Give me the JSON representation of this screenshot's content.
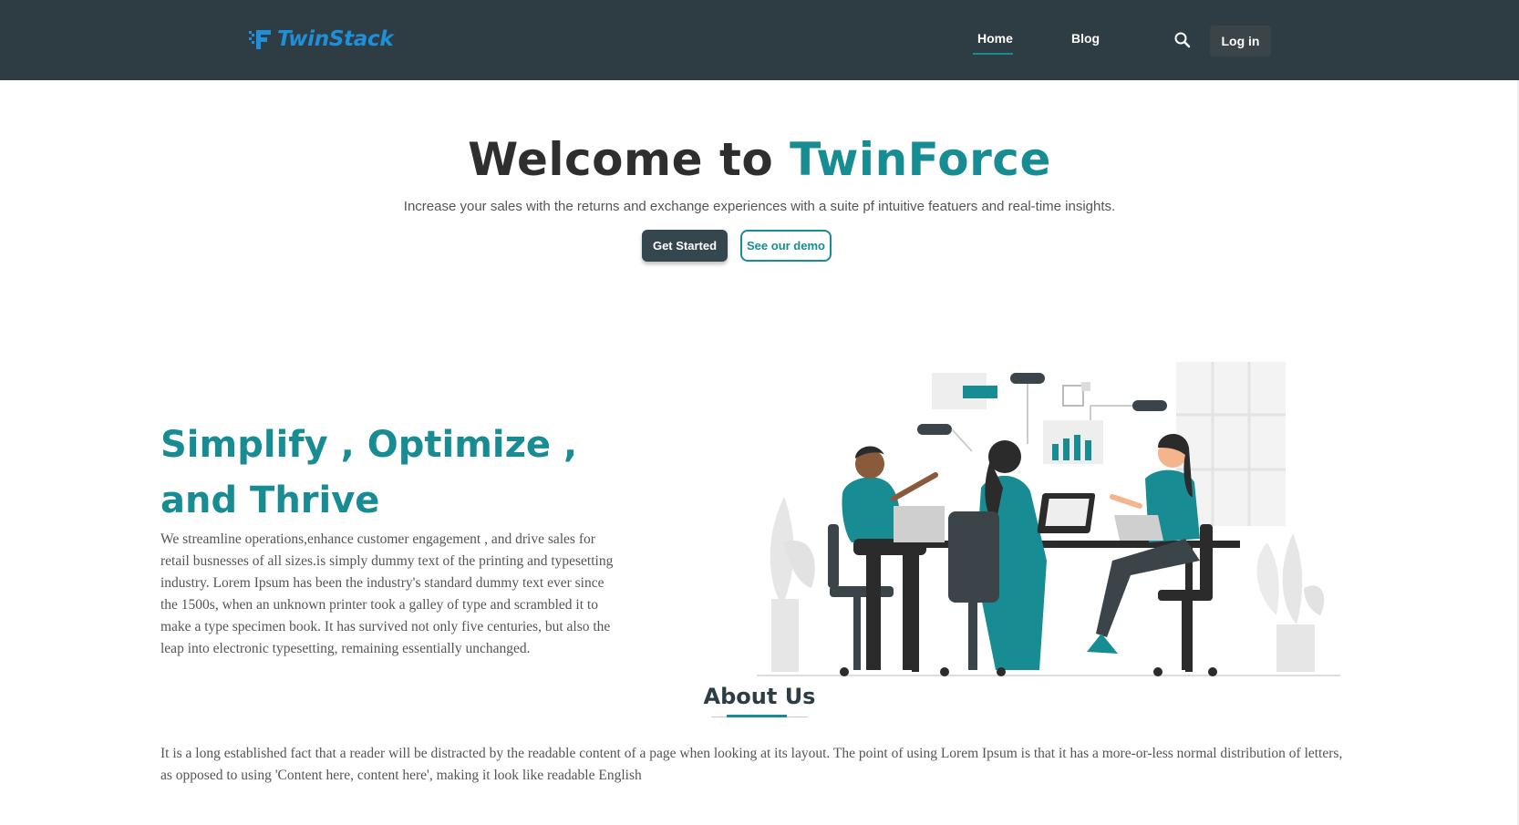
{
  "header": {
    "logo_text": "TwinStack",
    "logo_icon": "twinstack-logo-icon",
    "nav": [
      {
        "label": "Home",
        "active": true
      },
      {
        "label": "Blog",
        "active": false
      }
    ],
    "search_icon": "search-icon",
    "login_label": "Log in"
  },
  "hero": {
    "title_prefix": "Welcome to ",
    "title_accent": "TwinForce",
    "subtitle": "Increase your sales with the returns and exchange experiences with a suite pf intuitive featuers and real-time insights.",
    "primary_button": "Get Started",
    "secondary_button": "See our demo"
  },
  "feature": {
    "title": "Simplify , Optimize , and Thrive",
    "body": "We streamline operations,enhance customer engagement , and drive sales for retail busnesses of all sizes.is simply dummy text of the printing and typesetting industry. Lorem Ipsum has been the industry's standard dummy text ever since the 1500s, when an unknown printer took a galley of type and scrambled it to make a type specimen book. It has survived not only five centuries, but also the leap into electronic typesetting, remaining essentially unchanged.",
    "image": "team-meeting-illustration"
  },
  "about": {
    "title": "About Us",
    "body": "It is a long established fact that a reader will be distracted by the readable content of a page when looking at its layout. The point of using Lorem Ipsum is that it has a more-or-less normal distribution of letters, as opposed to using 'Content here, content here', making it look like readable English"
  },
  "colors": {
    "header_bg": "#2e3d44",
    "accent": "#178c93",
    "logo_blue": "#1e8fd8",
    "dark_button": "#34474f"
  }
}
